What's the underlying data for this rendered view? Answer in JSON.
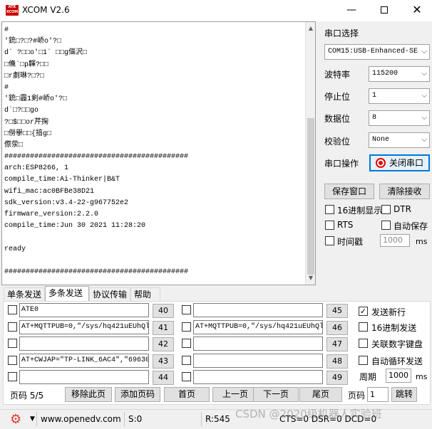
{
  "window": {
    "title": "XCOM V2.6",
    "icon_text": "ATK XCOM",
    "minimize": "—",
    "close": "✕"
  },
  "receive": {
    "lines": [
      "#",
      "'銃□?□?#峤o'?□",
      "d` ?□□o'□1` □□g傴沢□",
      "□儵`□p韗?□□",
      "□r劇琳?□?□",
      "#",
      "'銃□霾1剣#峤o'?□",
      "d`□?□□go",
      "?□$□□or芹掬",
      "□僗擧□□{揞g□",
      "傺荥□",
      "###########################################",
      "arch:ESP8266, 1",
      "compile_time:Ai-Thinker|B&T",
      "wifi_mac:ac0BFBe38D21",
      "sdk_version:v3.4-22-g967752e2",
      "firmware_version:2.2.0",
      "compile_time:Jun 30 2021 11:28:20",
      "",
      "ready",
      "",
      "###########################################"
    ]
  },
  "settings": {
    "port_select_label": "串口选择",
    "port_value": "COM15:USB-Enhanced-SE",
    "baud_label": "波特率",
    "baud_value": "115200",
    "stop_label": "停止位",
    "stop_value": "1",
    "data_label": "数据位",
    "data_value": "8",
    "parity_label": "校验位",
    "parity_value": "None",
    "op_label": "串口操作",
    "close_port_btn": "关闭串口",
    "save_window_btn": "保存窗口",
    "clear_recv_btn": "清除接收",
    "hex_display": "16进制显示",
    "dtr": "DTR",
    "rts": "RTS",
    "auto_save": "自动保存",
    "timestamp": "时间戳",
    "timestamp_ms_value": "1000",
    "ms": "ms"
  },
  "tabs": [
    "单条发送",
    "多条发送",
    "协议传输",
    "帮助"
  ],
  "multi_send": {
    "left_rows": [
      {
        "text": "ATE0",
        "num": "40",
        "checked": false
      },
      {
        "text": "AT+MQTTPUB=0,\"/sys/hq421uEUhQl",
        "num": "41",
        "checked": false
      },
      {
        "text": "",
        "num": "42",
        "checked": false
      },
      {
        "text": "AT+CWJAP=\"TP-LINK_6AC4\",\"69630",
        "num": "43",
        "checked": false
      },
      {
        "text": "",
        "num": "44",
        "checked": false
      }
    ],
    "right_rows": [
      {
        "text": "",
        "num": "45",
        "checked": false
      },
      {
        "text": "AT+MQTTPUB=0,\"/sys/hq421uEUhQl",
        "num": "46",
        "checked": false
      },
      {
        "text": "",
        "num": "47",
        "checked": false
      },
      {
        "text": "",
        "num": "48",
        "checked": false
      },
      {
        "text": "",
        "num": "49",
        "checked": false
      }
    ],
    "send_newline": "发送新行",
    "send_newline_checked": "✓",
    "hex_send": "16进制发送",
    "link_keyboard": "关联数字键盘",
    "auto_loop": "自动循环发送",
    "period_label": "周期",
    "period_value": "1000",
    "period_unit": "ms",
    "page_code": "页码 5/5",
    "remove_page": "移除此页",
    "add_page": "添加页码",
    "first_page": "首页",
    "prev_page": "上一页",
    "next_page": "下一页",
    "last_page": "尾页",
    "page_code_label": "页码",
    "page_input": "1",
    "jump": "跳转"
  },
  "statusbar": {
    "url": "www.openedv.com",
    "sent": "S:0",
    "recv": "R:545",
    "signals": "CTS=0 DSR=0 DCD=0",
    "watermark": "CSDN @2020级机器人实验班"
  }
}
